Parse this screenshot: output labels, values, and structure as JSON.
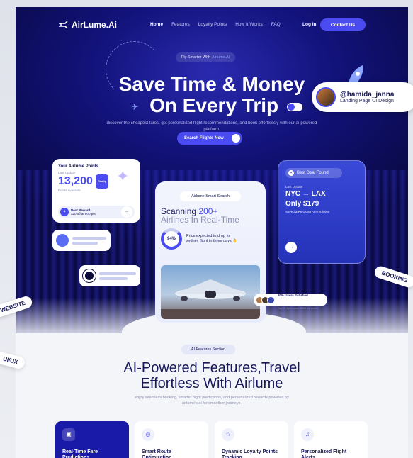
{
  "nav": {
    "logo_text": "AirLume.Ai",
    "links": [
      "Home",
      "Features",
      "Loyalty Points",
      "How It Works",
      "FAQ"
    ],
    "login": "Log In",
    "contact": "Contact Us"
  },
  "hero": {
    "pill_text": "Fly Smarter With",
    "pill_highlight": "Airlume.Ai",
    "title_line1": "Save Time & Money",
    "title_line2": "On Every Trip",
    "subtitle": "discover the cheapest fares, get personalized flight recommendations, and book effortlessly with our ai-powered platform.",
    "cta": "Search Flights Now",
    "cta_arrow": "→"
  },
  "points_card": {
    "title": "Your Airlume Points",
    "last_update": "Last Update",
    "points": "13,200",
    "badge": "Ready",
    "points_label": "Points Available",
    "reward_title": "Next Reward",
    "reward_desc": "$20 off at 800 pts",
    "go": "→"
  },
  "scan_card": {
    "pill": "Airlume Smart Search",
    "line1a": "Scanning",
    "line1b": "200+",
    "line2": "Airlines In Real-Time",
    "percent": "94%",
    "prediction": "Price expected to drop for sydney flight in three days 👌"
  },
  "deal_card": {
    "pill": "Best Deal Found",
    "last_update": "Last Update",
    "route": "NYC → LAX",
    "price": "Only $179",
    "saved_prefix": "Saved",
    "saved_pct": "28%",
    "saved_suffix": "Using AI Prediction",
    "go": "→"
  },
  "profile": {
    "handle": "@hamida_janna",
    "role": "Landing Page UI Design"
  },
  "users_badge": {
    "title": "80% Users Satisfied",
    "desc": "Top 8% flyers saved $400 per month"
  },
  "features": {
    "pill": "AI Features Section",
    "title_line1": "AI-Powered Features,Travel",
    "title_line2": "Effortless With Airlume",
    "subtitle": "enjoy seamless booking, smarter flight predictions, and personalized rewards powered by airlume's ai for smoother journeys.",
    "cards": [
      {
        "title": "Real-Time Fare Predictions",
        "icon": "chart-icon",
        "active": true
      },
      {
        "title": "Smart Route Optimization",
        "icon": "location-pin-icon",
        "active": false
      },
      {
        "title": "Dynamic Loyalty Points Tracking",
        "icon": "star-icon",
        "active": false
      },
      {
        "title": "Personalized Flight Alerts",
        "icon": "bell-icon",
        "active": false
      }
    ]
  },
  "tags": {
    "website": "WEBSITE",
    "uiux": "UI/UX",
    "booking": "BOOKING"
  },
  "colors": {
    "accent": "#4a4cf2",
    "hero_dark": "#08083f",
    "text_dark": "#18185a"
  }
}
